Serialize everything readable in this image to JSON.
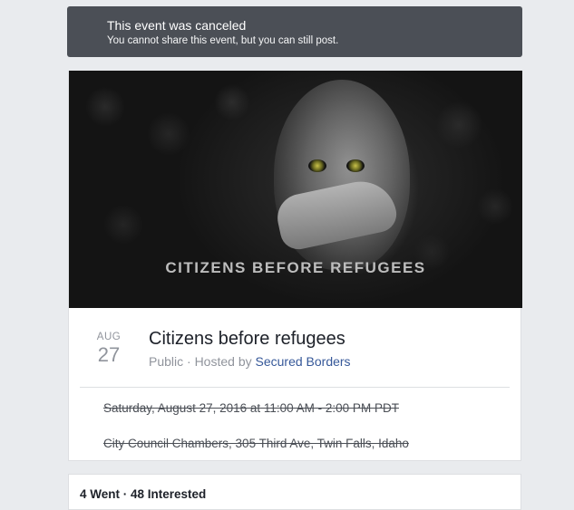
{
  "banner": {
    "title": "This event was canceled",
    "subtitle": "You cannot share this event, but you can still post."
  },
  "cover": {
    "caption": "CITIZENS BEFORE REFUGEES"
  },
  "event": {
    "month": "AUG",
    "day": "27",
    "title": "Citizens before refugees",
    "privacy_host_prefix": "Public · Hosted by ",
    "host": "Secured Borders",
    "datetime": "Saturday, August 27, 2016 at 11:00 AM - 2:00 PM PDT",
    "location": "City Council Chambers, 305 Third Ave, Twin Falls, Idaho"
  },
  "stats": {
    "summary": "4 Went · 48 Interested"
  },
  "colors": {
    "banner_bg": "#4b4f56",
    "link": "#365899",
    "page_bg": "#e9ebee"
  }
}
